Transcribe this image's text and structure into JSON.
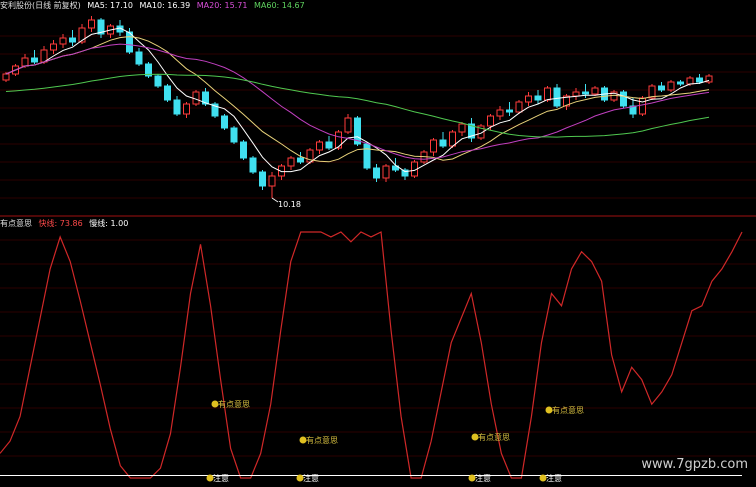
{
  "main_panel": {
    "title": "安利股份(日线 前复权)",
    "ma_labels": [
      {
        "text": "MA5: 17.10",
        "color": "#ffffff"
      },
      {
        "text": "MA10: 16.39",
        "color": "#ffffff"
      },
      {
        "text": "MA20: 15.71",
        "color": "#d94fd9"
      },
      {
        "text": "MA60: 14.67",
        "color": "#5fd35f"
      }
    ],
    "low_marker": "10.18"
  },
  "sub_panel": {
    "title": "有点意思",
    "fast_label": "快线: 73.86",
    "slow_label": "慢线: 1.00",
    "signal_label": "有点意思",
    "bottom_marker": "注意"
  },
  "watermark": "www.7gpzb.com",
  "colors": {
    "up": "#ff3b3b",
    "down": "#40e0f0",
    "ma5": "#ffffff",
    "ma10": "#e8d27a",
    "ma20": "#c040c0",
    "ma60": "#50c850",
    "osc": "#d02828",
    "grid": "#5a0000"
  },
  "chart_data": [
    {
      "type": "candlestick",
      "title": "安利股份(日线 前复权)",
      "ylim": [
        9.5,
        19.5
      ],
      "annotations": [
        "10.18"
      ],
      "candles": [
        [
          16.1,
          16.5,
          16.0,
          16.4
        ],
        [
          16.4,
          16.9,
          16.3,
          16.8
        ],
        [
          16.8,
          17.4,
          16.7,
          17.2
        ],
        [
          17.2,
          17.6,
          16.9,
          17.0
        ],
        [
          17.0,
          17.8,
          16.9,
          17.6
        ],
        [
          17.6,
          18.1,
          17.4,
          17.9
        ],
        [
          17.9,
          18.4,
          17.7,
          18.2
        ],
        [
          18.2,
          18.6,
          17.8,
          18.0
        ],
        [
          18.0,
          18.9,
          17.9,
          18.7
        ],
        [
          18.7,
          19.3,
          18.5,
          19.1
        ],
        [
          19.1,
          19.2,
          18.2,
          18.4
        ],
        [
          18.4,
          18.9,
          18.2,
          18.8
        ],
        [
          18.8,
          19.1,
          18.3,
          18.5
        ],
        [
          18.5,
          18.7,
          17.4,
          17.5
        ],
        [
          17.5,
          17.7,
          16.8,
          16.9
        ],
        [
          16.9,
          17.0,
          16.2,
          16.3
        ],
        [
          16.3,
          16.4,
          15.7,
          15.8
        ],
        [
          15.8,
          15.9,
          15.0,
          15.1
        ],
        [
          15.1,
          15.3,
          14.3,
          14.4
        ],
        [
          14.4,
          15.0,
          14.2,
          14.9
        ],
        [
          14.9,
          15.6,
          14.8,
          15.5
        ],
        [
          15.5,
          15.7,
          14.8,
          14.9
        ],
        [
          14.9,
          15.0,
          14.2,
          14.3
        ],
        [
          14.3,
          14.4,
          13.6,
          13.7
        ],
        [
          13.7,
          13.8,
          12.9,
          13.0
        ],
        [
          13.0,
          13.1,
          12.1,
          12.2
        ],
        [
          12.2,
          12.3,
          11.4,
          11.5
        ],
        [
          11.5,
          11.6,
          10.6,
          10.8
        ],
        [
          10.8,
          11.5,
          10.2,
          11.3
        ],
        [
          11.3,
          11.9,
          11.1,
          11.8
        ],
        [
          11.8,
          12.3,
          11.6,
          12.2
        ],
        [
          12.2,
          12.5,
          11.9,
          12.0
        ],
        [
          12.0,
          12.7,
          11.9,
          12.6
        ],
        [
          12.6,
          13.1,
          12.4,
          13.0
        ],
        [
          13.0,
          13.3,
          12.6,
          12.7
        ],
        [
          12.7,
          13.6,
          12.6,
          13.5
        ],
        [
          13.5,
          14.4,
          13.4,
          14.2
        ],
        [
          14.2,
          14.3,
          12.8,
          12.9
        ],
        [
          12.9,
          13.0,
          11.6,
          11.7
        ],
        [
          11.7,
          11.9,
          11.0,
          11.2
        ],
        [
          11.2,
          11.9,
          11.0,
          11.8
        ],
        [
          11.8,
          12.2,
          11.5,
          11.6
        ],
        [
          11.6,
          11.7,
          11.1,
          11.3
        ],
        [
          11.3,
          12.1,
          11.2,
          12.0
        ],
        [
          12.0,
          12.6,
          11.9,
          12.5
        ],
        [
          12.5,
          13.2,
          12.3,
          13.1
        ],
        [
          13.1,
          13.5,
          12.7,
          12.8
        ],
        [
          12.8,
          13.6,
          12.7,
          13.5
        ],
        [
          13.5,
          14.0,
          13.3,
          13.9
        ],
        [
          13.9,
          14.2,
          13.0,
          13.2
        ],
        [
          13.2,
          13.9,
          13.1,
          13.8
        ],
        [
          13.8,
          14.4,
          13.6,
          14.3
        ],
        [
          14.3,
          14.8,
          14.1,
          14.6
        ],
        [
          14.6,
          15.0,
          14.3,
          14.5
        ],
        [
          14.5,
          15.1,
          14.4,
          15.0
        ],
        [
          15.0,
          15.5,
          14.8,
          15.3
        ],
        [
          15.3,
          15.6,
          14.9,
          15.1
        ],
        [
          15.1,
          15.8,
          15.0,
          15.7
        ],
        [
          15.7,
          15.9,
          14.7,
          14.8
        ],
        [
          14.8,
          15.4,
          14.6,
          15.3
        ],
        [
          15.3,
          15.7,
          15.1,
          15.5
        ],
        [
          15.5,
          15.9,
          15.2,
          15.4
        ],
        [
          15.4,
          15.8,
          15.3,
          15.7
        ],
        [
          15.7,
          15.8,
          15.0,
          15.1
        ],
        [
          15.1,
          15.6,
          15.0,
          15.5
        ],
        [
          15.5,
          15.6,
          14.7,
          14.8
        ],
        [
          14.8,
          15.2,
          14.2,
          14.4
        ],
        [
          14.4,
          15.3,
          14.3,
          15.2
        ],
        [
          15.2,
          15.9,
          15.1,
          15.8
        ],
        [
          15.8,
          16.0,
          15.5,
          15.6
        ],
        [
          15.6,
          16.1,
          15.5,
          16.0
        ],
        [
          16.0,
          16.1,
          15.8,
          15.9
        ],
        [
          15.9,
          16.3,
          15.8,
          16.2
        ],
        [
          16.2,
          16.4,
          15.9,
          16.0
        ],
        [
          16.0,
          16.4,
          15.9,
          16.3
        ]
      ]
    },
    {
      "type": "line",
      "title": "有点意思",
      "ylim": [
        0,
        100
      ],
      "series": [
        {
          "name": "快线",
          "values": [
            10,
            15,
            25,
            45,
            65,
            85,
            98,
            88,
            72,
            55,
            38,
            20,
            5,
            0,
            0,
            0,
            4,
            18,
            45,
            75,
            95,
            70,
            40,
            12,
            0,
            0,
            10,
            30,
            60,
            88,
            100,
            100,
            100,
            98,
            100,
            96,
            100,
            98,
            100,
            60,
            25,
            0,
            0,
            15,
            35,
            55,
            65,
            75,
            55,
            30,
            10,
            0,
            0,
            25,
            55,
            75,
            70,
            85,
            92,
            88,
            80,
            50,
            35,
            45,
            40,
            30,
            35,
            42,
            55,
            68,
            70,
            80,
            85,
            92,
            100
          ]
        },
        {
          "name": "慢线",
          "values": [
            1,
            1,
            1,
            1,
            1,
            1,
            1,
            1,
            1,
            1,
            1,
            1,
            1,
            1,
            1,
            1,
            1,
            1,
            1,
            1,
            1,
            1,
            1,
            1,
            1,
            1,
            1,
            1,
            1,
            1,
            1,
            1,
            1,
            1,
            1,
            1,
            1,
            1,
            1,
            1,
            1,
            1,
            1,
            1,
            1,
            1,
            1,
            1,
            1,
            1,
            1,
            1,
            1,
            1,
            1,
            1,
            1,
            1,
            1,
            1,
            1,
            1,
            1,
            1,
            1,
            1,
            1,
            1,
            1,
            1,
            1,
            1,
            1,
            1,
            1
          ]
        }
      ],
      "annotations": [
        "有点意思",
        "注意"
      ]
    }
  ]
}
